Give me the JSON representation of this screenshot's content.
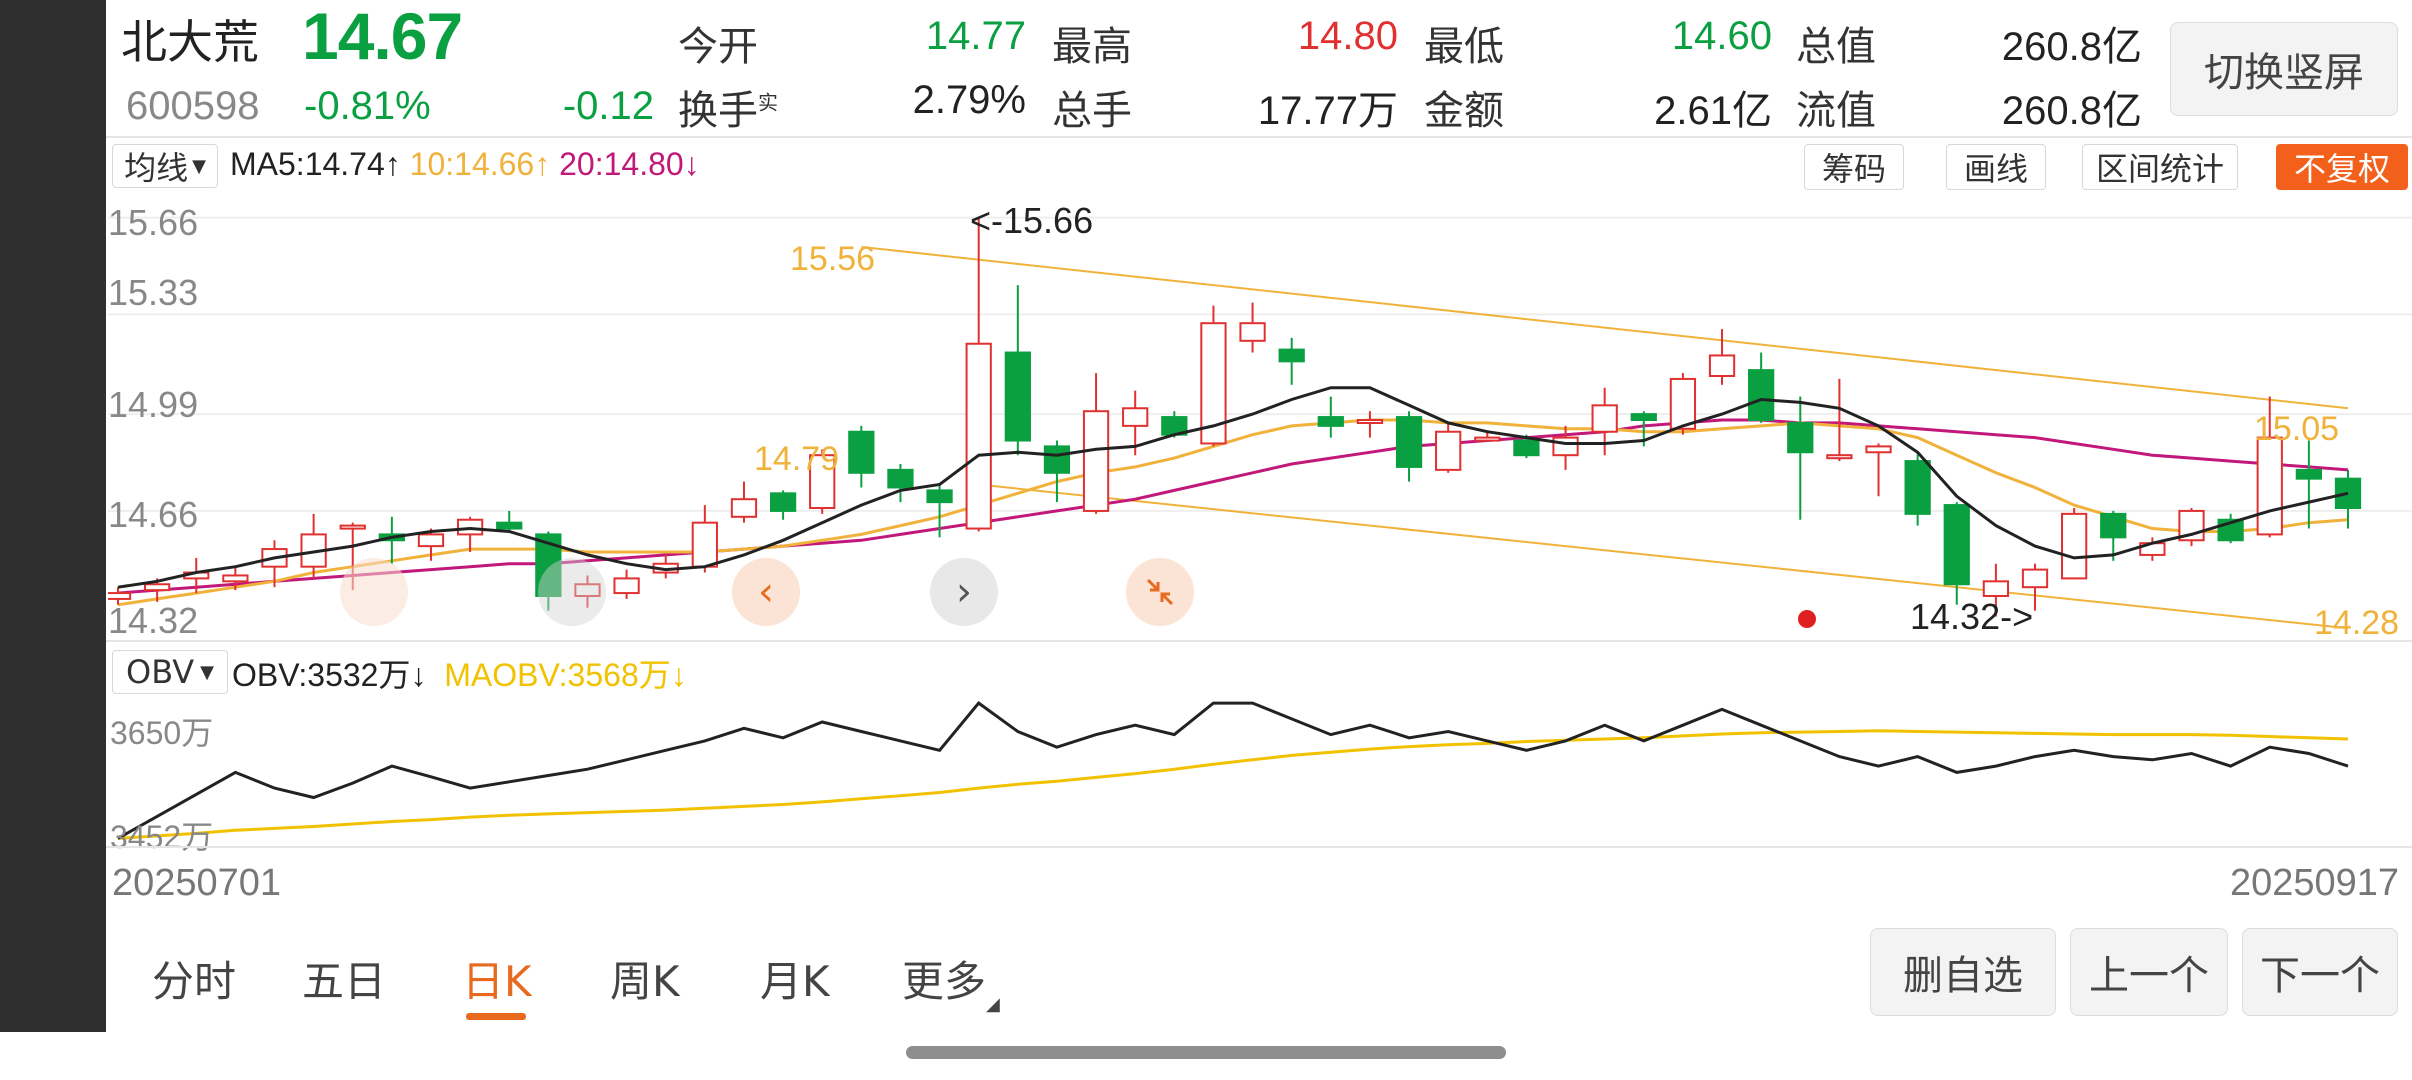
{
  "stock": {
    "name": "北大荒",
    "price": "14.67",
    "code": "600598",
    "change_pct": "-0.81%",
    "change": "-0.12"
  },
  "quote": {
    "open_label": "今开",
    "open": "14.77",
    "high_label": "最高",
    "high": "14.80",
    "low_label": "最低",
    "low": "14.60",
    "mktcap_label": "总值",
    "mktcap": "260.8亿",
    "turnover_label": "换手",
    "turnover_sup": "实",
    "turnover": "2.79%",
    "volume_label": "总手",
    "volume": "17.77万",
    "amount_label": "金额",
    "amount": "2.61亿",
    "float_label": "流值",
    "float_cap": "260.8亿"
  },
  "switch_label": "切换竖屏",
  "toolbar": {
    "ma_select": "均线",
    "ma5": "MA5:14.74",
    "ma10": "10:14.66",
    "ma20": "20:14.80",
    "up_arrow": "↑",
    "down_arrow": "↓",
    "chips": "筹码",
    "draw": "画线",
    "range_stats": "区间统计",
    "no_adjust": "不复权"
  },
  "colors": {
    "up": "#e03030",
    "down": "#0aa042",
    "ma5": "#222222",
    "ma10": "#f0b23a",
    "ma20": "#c2187a",
    "accent": "#e86a1f"
  },
  "main_chart_axis": {
    "y_ticks": [
      "15.66",
      "15.33",
      "14.99",
      "14.66",
      "14.32"
    ],
    "right_low": "14.28"
  },
  "annotations": {
    "high_mark": "<-15.66",
    "low_mark": "14.32->",
    "trend_15_56": "15.56",
    "trend_14_79": "14.79",
    "trend_15_05": "15.05"
  },
  "nav_icons": [
    "chevron-left-icon",
    "chevron-right-icon",
    "collapse-icon"
  ],
  "obv": {
    "select": "OBV",
    "obv": "OBV:3532万",
    "maobv": "MAOBV:3568万",
    "y_top": "3650万",
    "y_bottom": "3452万"
  },
  "dates": {
    "start": "20250701",
    "end": "20250917"
  },
  "period_tabs": [
    "分时",
    "五日",
    "日K",
    "周K",
    "月K",
    "更多"
  ],
  "actions": {
    "remove_watch": "删自选",
    "prev": "上一个",
    "next": "下一个"
  },
  "chart_data": {
    "type": "candlestick",
    "ylim": [
      14.32,
      15.66
    ],
    "candles": [
      {
        "o": 14.36,
        "c": 14.38,
        "h": 14.4,
        "l": 14.34
      },
      {
        "o": 14.39,
        "c": 14.41,
        "h": 14.43,
        "l": 14.35
      },
      {
        "o": 14.43,
        "c": 14.45,
        "h": 14.5,
        "l": 14.38
      },
      {
        "o": 14.42,
        "c": 14.44,
        "h": 14.47,
        "l": 14.39
      },
      {
        "o": 14.47,
        "c": 14.53,
        "h": 14.56,
        "l": 14.4
      },
      {
        "o": 14.47,
        "c": 14.58,
        "h": 14.65,
        "l": 14.43
      },
      {
        "o": 14.61,
        "c": 14.61,
        "h": 14.62,
        "l": 14.39
      },
      {
        "o": 14.58,
        "c": 14.56,
        "h": 14.64,
        "l": 14.48
      },
      {
        "o": 14.54,
        "c": 14.58,
        "h": 14.6,
        "l": 14.49
      },
      {
        "o": 14.58,
        "c": 14.63,
        "h": 14.64,
        "l": 14.52
      },
      {
        "o": 14.62,
        "c": 14.6,
        "h": 14.66,
        "l": 14.59
      },
      {
        "o": 14.58,
        "c": 14.37,
        "h": 14.59,
        "l": 14.32
      },
      {
        "o": 14.37,
        "c": 14.41,
        "h": 14.44,
        "l": 14.33
      },
      {
        "o": 14.38,
        "c": 14.43,
        "h": 14.46,
        "l": 14.36
      },
      {
        "o": 14.45,
        "c": 14.48,
        "h": 14.51,
        "l": 14.43
      },
      {
        "o": 14.47,
        "c": 14.62,
        "h": 14.68,
        "l": 14.45
      },
      {
        "o": 14.64,
        "c": 14.7,
        "h": 14.76,
        "l": 14.62
      },
      {
        "o": 14.72,
        "c": 14.66,
        "h": 14.73,
        "l": 14.63
      },
      {
        "o": 14.67,
        "c": 14.85,
        "h": 14.87,
        "l": 14.65
      },
      {
        "o": 14.93,
        "c": 14.79,
        "h": 14.95,
        "l": 14.74
      },
      {
        "o": 14.8,
        "c": 14.74,
        "h": 14.82,
        "l": 14.69
      },
      {
        "o": 14.73,
        "c": 14.69,
        "h": 14.75,
        "l": 14.57
      },
      {
        "o": 14.6,
        "c": 15.23,
        "h": 15.66,
        "l": 14.59
      },
      {
        "o": 15.2,
        "c": 14.9,
        "h": 15.43,
        "l": 14.85
      },
      {
        "o": 14.88,
        "c": 14.79,
        "h": 14.9,
        "l": 14.69
      },
      {
        "o": 14.66,
        "c": 15.0,
        "h": 15.13,
        "l": 14.65
      },
      {
        "o": 14.95,
        "c": 15.01,
        "h": 15.07,
        "l": 14.85
      },
      {
        "o": 14.98,
        "c": 14.92,
        "h": 15.0,
        "l": 14.91
      },
      {
        "o": 14.89,
        "c": 15.3,
        "h": 15.36,
        "l": 14.88
      },
      {
        "o": 15.24,
        "c": 15.3,
        "h": 15.37,
        "l": 15.2
      },
      {
        "o": 15.21,
        "c": 15.17,
        "h": 15.25,
        "l": 15.09
      },
      {
        "o": 14.98,
        "c": 14.95,
        "h": 15.05,
        "l": 14.91
      },
      {
        "o": 14.97,
        "c": 14.97,
        "h": 15.0,
        "l": 14.91
      },
      {
        "o": 14.98,
        "c": 14.81,
        "h": 15.0,
        "l": 14.76
      },
      {
        "o": 14.8,
        "c": 14.93,
        "h": 14.96,
        "l": 14.79
      },
      {
        "o": 14.91,
        "c": 14.91,
        "h": 14.93,
        "l": 14.9
      },
      {
        "o": 14.9,
        "c": 14.85,
        "h": 14.92,
        "l": 14.84
      },
      {
        "o": 14.85,
        "c": 14.91,
        "h": 14.95,
        "l": 14.8
      },
      {
        "o": 14.93,
        "c": 15.02,
        "h": 15.08,
        "l": 14.85
      },
      {
        "o": 14.99,
        "c": 14.97,
        "h": 15.0,
        "l": 14.88
      },
      {
        "o": 14.94,
        "c": 15.11,
        "h": 15.13,
        "l": 14.92
      },
      {
        "o": 15.12,
        "c": 15.19,
        "h": 15.28,
        "l": 15.09
      },
      {
        "o": 15.14,
        "c": 14.97,
        "h": 15.2,
        "l": 14.96
      },
      {
        "o": 14.96,
        "c": 14.86,
        "h": 15.05,
        "l": 14.63
      },
      {
        "o": 14.85,
        "c": 14.85,
        "h": 15.11,
        "l": 14.83
      },
      {
        "o": 14.86,
        "c": 14.88,
        "h": 14.89,
        "l": 14.71
      },
      {
        "o": 14.83,
        "c": 14.65,
        "h": 14.86,
        "l": 14.61
      },
      {
        "o": 14.68,
        "c": 14.41,
        "h": 14.69,
        "l": 14.34
      },
      {
        "o": 14.37,
        "c": 14.42,
        "h": 14.48,
        "l": 14.3
      },
      {
        "o": 14.4,
        "c": 14.46,
        "h": 14.48,
        "l": 14.32
      },
      {
        "o": 14.43,
        "c": 14.65,
        "h": 14.67,
        "l": 14.43
      },
      {
        "o": 14.65,
        "c": 14.57,
        "h": 14.66,
        "l": 14.49
      },
      {
        "o": 14.51,
        "c": 14.55,
        "h": 14.57,
        "l": 14.49
      },
      {
        "o": 14.56,
        "c": 14.66,
        "h": 14.67,
        "l": 14.54
      },
      {
        "o": 14.63,
        "c": 14.56,
        "h": 14.65,
        "l": 14.55
      },
      {
        "o": 14.58,
        "c": 14.91,
        "h": 15.05,
        "l": 14.57
      },
      {
        "o": 14.8,
        "c": 14.77,
        "h": 14.9,
        "l": 14.6
      },
      {
        "o": 14.77,
        "c": 14.67,
        "h": 14.8,
        "l": 14.6
      }
    ],
    "ma5": [
      14.4,
      14.42,
      14.45,
      14.47,
      14.5,
      14.52,
      14.54,
      14.57,
      14.59,
      14.6,
      14.59,
      14.55,
      14.51,
      14.48,
      14.46,
      14.47,
      14.51,
      14.56,
      14.62,
      14.68,
      14.73,
      14.75,
      14.85,
      14.86,
      14.85,
      14.87,
      14.88,
      14.92,
      14.95,
      14.99,
      15.04,
      15.08,
      15.08,
      15.02,
      14.96,
      14.93,
      14.91,
      14.89,
      14.89,
      14.9,
      14.95,
      14.99,
      15.04,
      15.03,
      15.01,
      14.95,
      14.86,
      14.71,
      14.61,
      14.54,
      14.5,
      14.51,
      14.55,
      14.58,
      14.62,
      14.66,
      14.69,
      14.72
    ],
    "ma10": [
      14.34,
      14.36,
      14.38,
      14.4,
      14.42,
      14.45,
      14.47,
      14.49,
      14.51,
      14.53,
      14.53,
      14.53,
      14.52,
      14.52,
      14.52,
      14.52,
      14.53,
      14.54,
      14.56,
      14.58,
      14.61,
      14.64,
      14.68,
      14.72,
      14.76,
      14.79,
      14.81,
      14.84,
      14.88,
      14.92,
      14.95,
      14.96,
      14.97,
      14.97,
      14.96,
      14.96,
      14.95,
      14.94,
      14.94,
      14.93,
      14.93,
      14.94,
      14.95,
      14.96,
      14.95,
      14.94,
      14.91,
      14.85,
      14.79,
      14.74,
      14.68,
      14.64,
      14.6,
      14.59,
      14.59,
      14.6,
      14.62,
      14.63
    ],
    "ma20": [
      14.38,
      14.39,
      14.4,
      14.41,
      14.42,
      14.43,
      14.44,
      14.45,
      14.46,
      14.47,
      14.48,
      14.48,
      14.49,
      14.5,
      14.51,
      14.52,
      14.53,
      14.54,
      14.55,
      14.56,
      14.58,
      14.6,
      14.62,
      14.64,
      14.66,
      14.68,
      14.7,
      14.73,
      14.76,
      14.79,
      14.82,
      14.84,
      14.86,
      14.88,
      14.89,
      14.9,
      14.91,
      14.92,
      14.93,
      14.95,
      14.96,
      14.97,
      14.97,
      14.96,
      14.96,
      14.95,
      14.94,
      14.93,
      14.92,
      14.91,
      14.89,
      14.87,
      14.85,
      14.84,
      14.83,
      14.82,
      14.81,
      14.8
    ],
    "obv": [
      3452,
      3487,
      3522,
      3557,
      3532,
      3517,
      3540,
      3567,
      3550,
      3532,
      3542,
      3552,
      3562,
      3577,
      3592,
      3607,
      3627,
      3612,
      3637,
      3622,
      3607,
      3592,
      3667,
      3622,
      3597,
      3617,
      3632,
      3617,
      3667,
      3667,
      3642,
      3617,
      3632,
      3612,
      3622,
      3607,
      3592,
      3607,
      3632,
      3607,
      3632,
      3657,
      3632,
      3607,
      3582,
      3567,
      3582,
      3557,
      3567,
      3582,
      3592,
      3582,
      3577,
      3587,
      3567,
      3597,
      3587,
      3567
    ],
    "maobv": [
      3452,
      3456,
      3460,
      3465,
      3468,
      3471,
      3475,
      3479,
      3482,
      3486,
      3489,
      3491,
      3493,
      3495,
      3497,
      3500,
      3503,
      3506,
      3510,
      3515,
      3520,
      3525,
      3532,
      3538,
      3543,
      3549,
      3555,
      3562,
      3570,
      3577,
      3584,
      3589,
      3594,
      3598,
      3601,
      3603,
      3606,
      3608,
      3610,
      3612,
      3615,
      3618,
      3620,
      3621,
      3622,
      3623,
      3622,
      3621,
      3620,
      3619,
      3618,
      3617,
      3617,
      3617,
      3616,
      3614,
      3612,
      3610
    ]
  }
}
